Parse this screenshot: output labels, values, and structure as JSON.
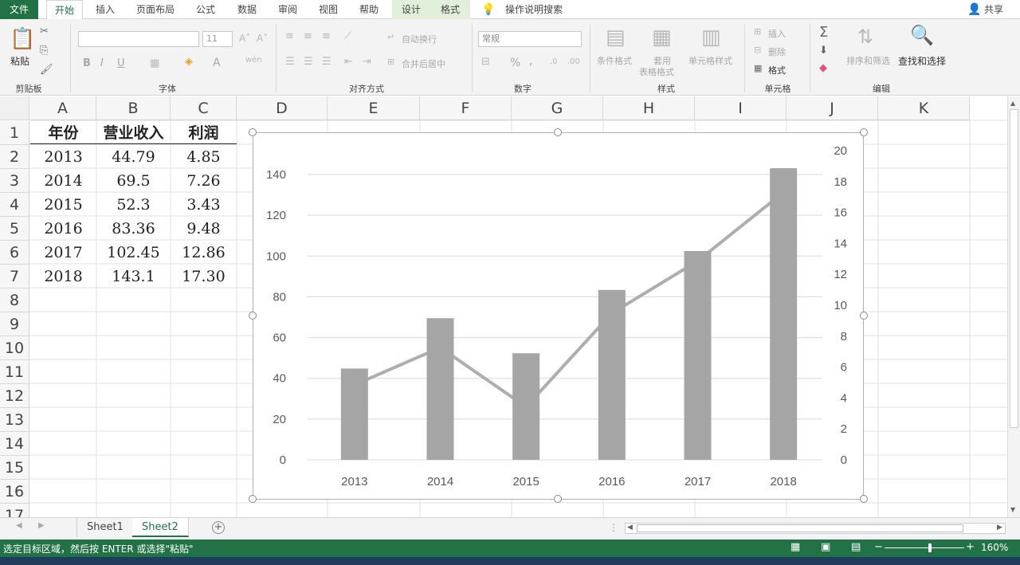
{
  "tabs": {
    "file": "文件",
    "home": "开始",
    "insert": "插入",
    "layout": "页面布局",
    "formula": "公式",
    "data": "数据",
    "review": "审阅",
    "view": "视图",
    "help": "帮助",
    "design": "设计",
    "format": "格式",
    "tell_me": "操作说明搜索",
    "share": "共享"
  },
  "ribbon": {
    "paste": "粘贴",
    "clipboard": "剪贴板",
    "font_group": "字体",
    "font_size": "11",
    "bold": "B",
    "italic": "I",
    "underline": "U",
    "font_color": "A",
    "wrap_text": "自动换行",
    "merge_center": "合并后居中",
    "align_group": "对齐方式",
    "number_format": "常规",
    "percent": "%",
    "comma": ",",
    "number_group": "数字",
    "cond_format": "条件格式",
    "table_format_1": "套用",
    "table_format_2": "表格格式",
    "cell_style": "单元格样式",
    "styles_group": "样式",
    "insert": "插入",
    "delete": "删除",
    "format": "格式",
    "cells_group": "单元格",
    "sort_filter": "排序和筛选",
    "find_select": "查找和选择",
    "edit_group": "编辑"
  },
  "columns": [
    "A",
    "B",
    "C",
    "D",
    "E",
    "F",
    "G",
    "H",
    "I",
    "J",
    "K"
  ],
  "rows": [
    "1",
    "2",
    "3",
    "4",
    "5",
    "6",
    "7",
    "8",
    "9",
    "10",
    "11",
    "12",
    "13",
    "14",
    "15",
    "16",
    "17"
  ],
  "table": {
    "headers": [
      "年份",
      "营业收入",
      "利润"
    ],
    "rows": [
      [
        "2013",
        "44.79",
        "4.85"
      ],
      [
        "2014",
        "69.5",
        "7.26"
      ],
      [
        "2015",
        "52.3",
        "3.43"
      ],
      [
        "2016",
        "83.36",
        "9.48"
      ],
      [
        "2017",
        "102.45",
        "12.86"
      ],
      [
        "2018",
        "143.1",
        "17.30"
      ]
    ]
  },
  "chart_data": {
    "type": "bar",
    "categories": [
      "2013",
      "2014",
      "2015",
      "2016",
      "2017",
      "2018"
    ],
    "series": [
      {
        "values": [
          44.79,
          69.5,
          52.3,
          83.36,
          102.45,
          143.1
        ],
        "kind": "bar",
        "axis": "left"
      },
      {
        "values": [
          4.85,
          7.26,
          3.43,
          9.48,
          12.86,
          17.3
        ],
        "kind": "line",
        "axis": "right"
      }
    ],
    "y_left": {
      "min": 0,
      "max": 140,
      "ticks": [
        0,
        20,
        40,
        60,
        80,
        100,
        120,
        140
      ]
    },
    "y_right": {
      "min": 0,
      "max": 20,
      "ticks": [
        0,
        2,
        4,
        6,
        8,
        10,
        12,
        14,
        16,
        18,
        20
      ]
    },
    "grid": true,
    "bar_color": "#a5a5a5",
    "line_color": "#a5a5a5"
  },
  "sheets": {
    "s1": "Sheet1",
    "s2": "Sheet2"
  },
  "status": {
    "message": "选定目标区域，然后按 ENTER 或选择\"粘贴\"",
    "zoom": "160%"
  },
  "colors": {
    "excel_green": "#217346"
  }
}
